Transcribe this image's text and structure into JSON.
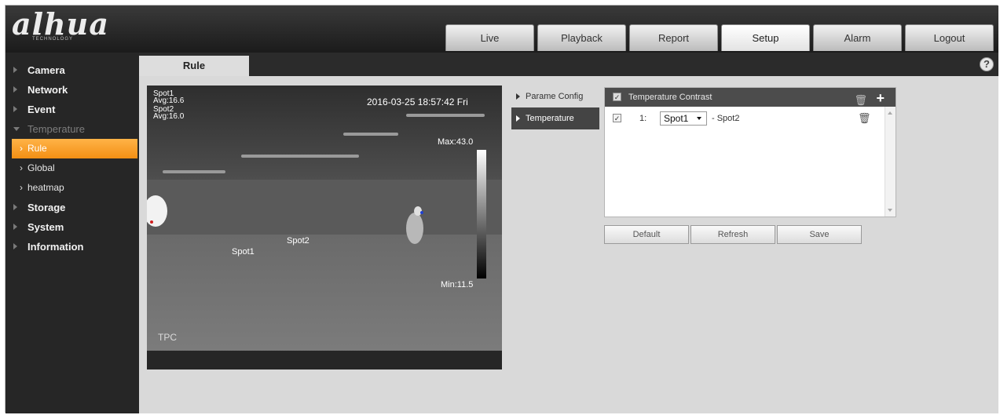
{
  "brand": {
    "logo_text": "alhua",
    "logo_sub": "TECHNOLOGY"
  },
  "nav": {
    "tabs": [
      "Live",
      "Playback",
      "Report",
      "Setup",
      "Alarm",
      "Logout"
    ],
    "active": "Setup"
  },
  "sidebar": {
    "camera": "Camera",
    "network": "Network",
    "event": "Event",
    "temperature": "Temperature",
    "rule": "Rule",
    "global": "Global",
    "heatmap": "heatmap",
    "storage": "Storage",
    "system": "System",
    "information": "Information"
  },
  "page": {
    "tab_title": "Rule",
    "help": "?"
  },
  "video": {
    "overlay_lines": [
      "Spot1",
      "Avg:16.6",
      "Spot2",
      "Avg:16.0"
    ],
    "timestamp": "2016-03-25 18:57:42 Fri",
    "max_label": "Max:43.0",
    "min_label": "Min:11.5",
    "spot1": "Spot1",
    "spot2": "Spot2",
    "tpc": "TPC"
  },
  "submenu": {
    "items": [
      "Parame Config",
      "Temperature"
    ],
    "active": "Temperature"
  },
  "rule_panel": {
    "header": "Temperature Contrast",
    "rows": [
      {
        "index": "1:",
        "spot_a": "Spot1",
        "separator": "- Spot2"
      }
    ]
  },
  "buttons": {
    "default": "Default",
    "refresh": "Refresh",
    "save": "Save"
  },
  "colors": {
    "accent": "#f38f14",
    "header_bg": "#1b1b1b",
    "sidebar_bg": "#262626",
    "panel_bg": "#d9d9d9"
  }
}
